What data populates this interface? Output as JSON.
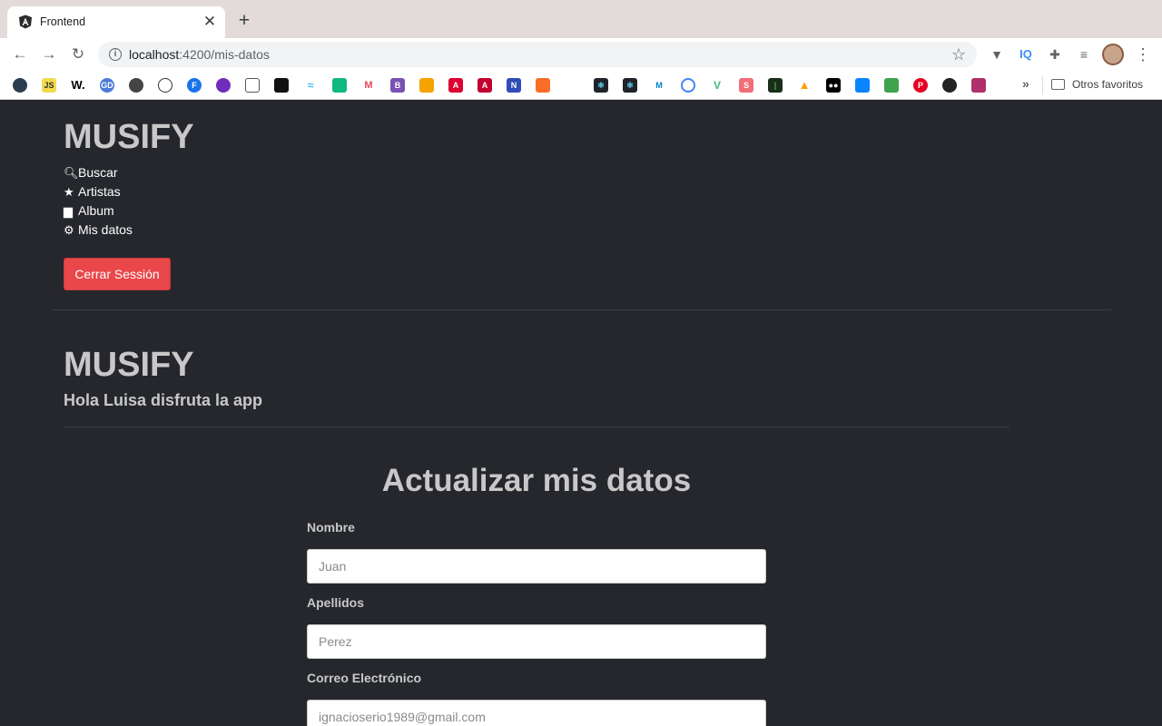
{
  "browser": {
    "tab_title": "Frontend",
    "url_host": "localhost",
    "url_path": ":4200/mis-datos",
    "bookmarks_folder": "Otros favoritos",
    "bookmarks_more": "»",
    "tab_close": "✕",
    "new_tab": "+"
  },
  "header": {
    "app_title": "MUSIFY",
    "nav": [
      {
        "icon": "search-icon",
        "label": "Buscar"
      },
      {
        "icon": "star-icon",
        "label": "Artistas"
      },
      {
        "icon": "book-icon",
        "label": "Album"
      },
      {
        "icon": "gear-icon",
        "label": "Mis datos"
      }
    ],
    "logout_label": "Cerrar Sessión"
  },
  "main": {
    "app_title": "MUSIFY",
    "greeting": "Hola Luisa disfruta la app"
  },
  "form": {
    "title": "Actualizar mis datos",
    "fields": [
      {
        "label": "Nombre",
        "placeholder": "Juan"
      },
      {
        "label": "Apellidos",
        "placeholder": "Perez"
      },
      {
        "label": "Correo Electrónico",
        "placeholder": "ignacioserio1989@gmail.com"
      }
    ]
  },
  "colors": {
    "page_bg": "#25272c",
    "danger": "#e9474a",
    "heading": "#c8c8c8"
  }
}
